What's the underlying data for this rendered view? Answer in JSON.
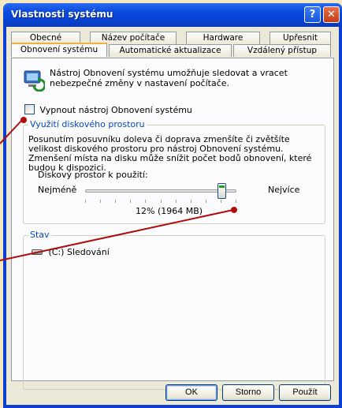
{
  "window": {
    "title": "Vlastnosti systému",
    "help_glyph": "?",
    "close_glyph": "✕"
  },
  "tabs": {
    "back_row": [
      "Obecné",
      "Název počítače",
      "Hardware",
      "Upřesnit"
    ],
    "front_row": [
      "Obnovení systému",
      "Automatické aktualizace",
      "Vzdálený přístup"
    ],
    "active": "Obnovení systému"
  },
  "panel": {
    "intro": "Nástroj Obnovení systému umožňuje sledovat a vracet nebezpečné změny v nastavení počítače.",
    "disable_checkbox_label": "Vypnout nástroj Obnovení systému",
    "disable_checked": false,
    "disk_group": {
      "title": "Využití diskového prostoru",
      "description": "Posunutím posuvníku doleva či doprava zmenšíte či zvětšíte velikost diskového prostoru pro nástroj Obnovení systému. Zmenšení místa na disku může snížit počet bodů obnovení, které budou k dispozici.",
      "slider_label": "Diskový prostor k použití:",
      "min_label": "Nejméně",
      "max_label": "Nejvíce",
      "value_text": "12% (1964 MB)",
      "slider_fraction": 0.93
    },
    "status_group": {
      "title": "Stav",
      "drive_text": "(C:) Sledování"
    }
  },
  "buttons": {
    "ok": "OK",
    "cancel": "Storno",
    "apply": "Použít"
  },
  "colors": {
    "callout": "#b00d0d",
    "group_title": "#0046d5",
    "titlebar": "#0842d4",
    "background": "#f5e6c2"
  }
}
